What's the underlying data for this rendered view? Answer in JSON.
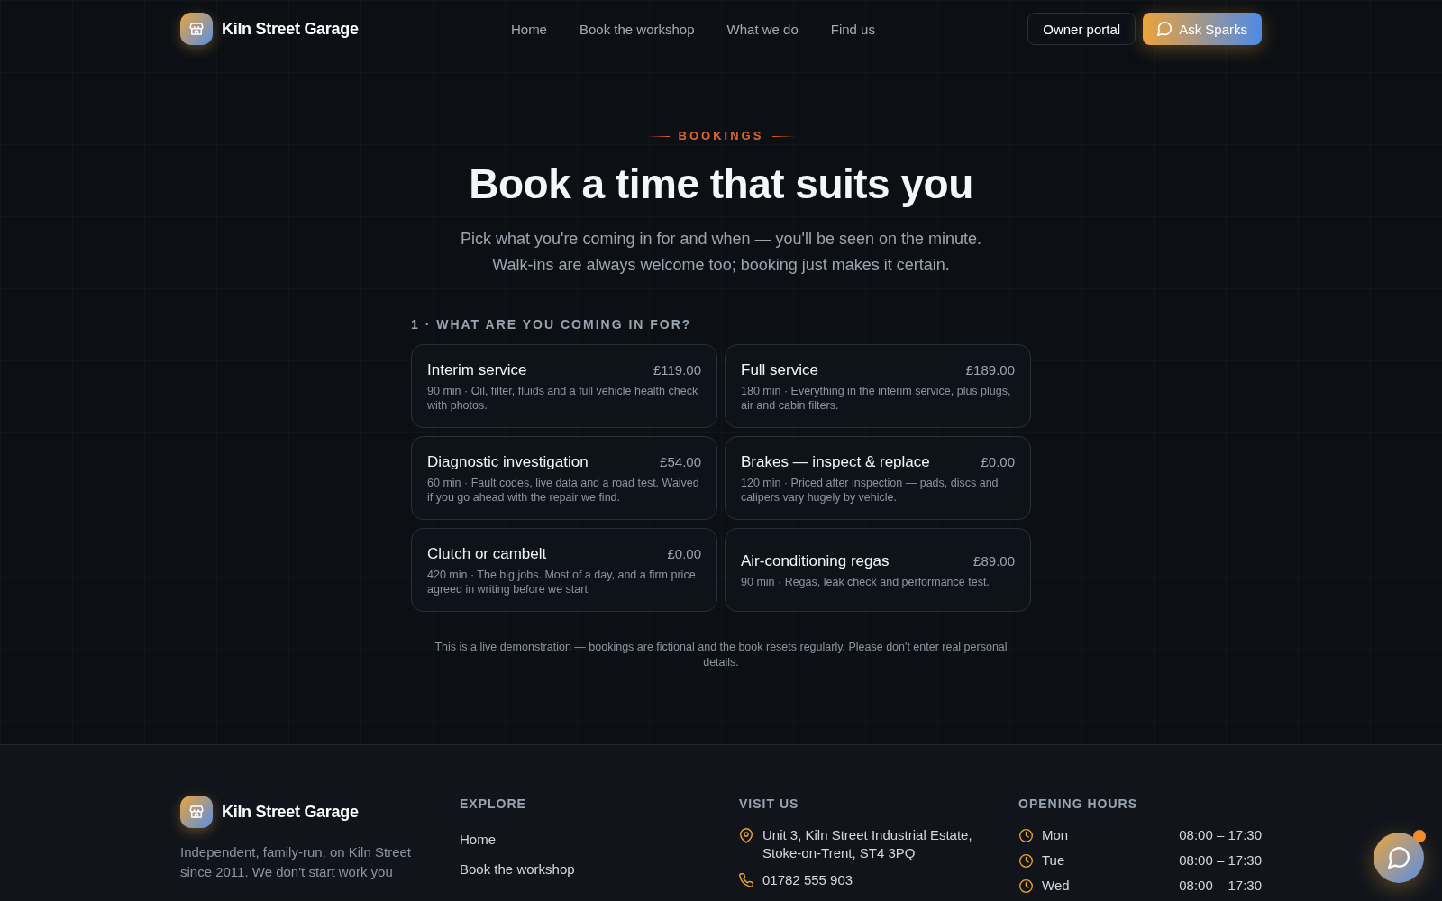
{
  "header": {
    "brand": "Kiln Street Garage",
    "nav": [
      {
        "label": "Home"
      },
      {
        "label": "Book the workshop"
      },
      {
        "label": "What we do"
      },
      {
        "label": "Find us"
      }
    ],
    "actions": [
      {
        "kind": "outline",
        "label": "Owner portal"
      },
      {
        "kind": "assistant",
        "label": "Ask Sparks"
      }
    ]
  },
  "hero": {
    "eyebrow": "BOOKINGS",
    "title": "Book a time that suits you",
    "subtitle": [
      "Pick what you're coming in for and when — you'll be seen on the minute.",
      "Walk-ins are always welcome too; booking just makes it certain."
    ]
  },
  "services": {
    "heading": "1 · WHAT ARE YOU COMING IN FOR?",
    "items": [
      {
        "name": "Interim service",
        "price": "£119.00",
        "description": "90 min · Oil, filter, fluids and a full vehicle health check with photos.",
        "selected": false
      },
      {
        "name": "Full service",
        "price": "£189.00",
        "description": "180 min · Everything in the interim service, plus plugs, air and cabin filters.",
        "selected": false
      },
      {
        "name": "Diagnostic investigation",
        "price": "£54.00",
        "description": "60 min · Fault codes, live data and a road test. Waived if you go ahead with the repair we find.",
        "selected": false
      },
      {
        "name": "Brakes — inspect & replace",
        "price": "£0.00",
        "description": "120 min · Priced after inspection — pads, discs and calipers vary hugely by vehicle.",
        "selected": false
      },
      {
        "name": "Clutch or cambelt",
        "price": "£0.00",
        "description": "420 min · The big jobs. Most of a day, and a firm price agreed in writing before we start.",
        "selected": false
      },
      {
        "name": "Air-conditioning regas",
        "price": "£89.00",
        "description": "90 min · Regas, leak check and performance test.",
        "selected": false
      }
    ]
  },
  "note": "This is a live demonstration — bookings are fictional and the book resets regularly. Please don't enter real personal details.",
  "footer": {
    "brand": "Kiln Street Garage",
    "description": "Independent, family-run, on Kiln Street since 2011. We don't start work you",
    "explore": {
      "heading": "EXPLORE",
      "links": [
        "Home",
        "Book the workshop"
      ]
    },
    "visit": {
      "heading": "VISIT US",
      "items": [
        {
          "kind": "address",
          "lines": [
            "Unit 3, Kiln Street Industrial Estate,",
            "Stoke-on-Trent, ST4 3PQ"
          ]
        },
        {
          "kind": "phone",
          "lines": [
            "01782 555 903"
          ]
        }
      ]
    },
    "hours": {
      "heading": "OPENING HOURS",
      "rows": [
        {
          "day": "Mon",
          "time": "08:00 – 17:30"
        },
        {
          "day": "Tue",
          "time": "08:00 – 17:30"
        },
        {
          "day": "Wed",
          "time": "08:00 – 17:30"
        }
      ]
    }
  },
  "chat_launcher": {
    "unread": true
  }
}
